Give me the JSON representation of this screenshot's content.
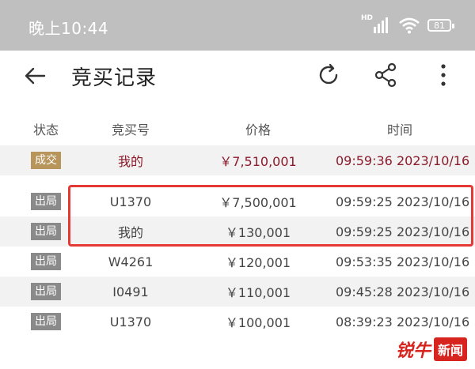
{
  "status_bar": {
    "time": "晚上10:44",
    "network": "HD",
    "battery": "81"
  },
  "app_bar": {
    "title": "竞买记录",
    "icons": [
      "back-arrow-icon",
      "refresh-icon",
      "share-icon",
      "more-vertical-icon"
    ]
  },
  "table": {
    "headers": {
      "status": "状态",
      "bid_no": "竞买号",
      "price": "价格",
      "time": "时间"
    },
    "rows": [
      {
        "status": "成交",
        "bid_no": "我的",
        "price": "￥7,510,001",
        "time": "09:59:36 2023/10/16"
      },
      {
        "status": "出局",
        "bid_no": "U1370",
        "price": "￥7,500,001",
        "time": "09:59:25 2023/10/16"
      },
      {
        "status": "出局",
        "bid_no": "我的",
        "price": "￥130,001",
        "time": "09:59:25 2023/10/16"
      },
      {
        "status": "出局",
        "bid_no": "W4261",
        "price": "￥120,001",
        "time": "09:53:35 2023/10/16"
      },
      {
        "status": "出局",
        "bid_no": "I0491",
        "price": "￥110,001",
        "time": "09:45:28 2023/10/16"
      },
      {
        "status": "出局",
        "bid_no": "U1370",
        "price": "￥100,001",
        "time": "08:39:23 2023/10/16"
      }
    ]
  },
  "watermark": {
    "logo": "锐牛",
    "text": "新闻"
  },
  "colors": {
    "status_bar": "#bfbfbf",
    "winner_text": "#8b1a2b",
    "win_badge": "#b8955a",
    "out_badge": "#8a8a8a",
    "highlight": "#e53935"
  }
}
